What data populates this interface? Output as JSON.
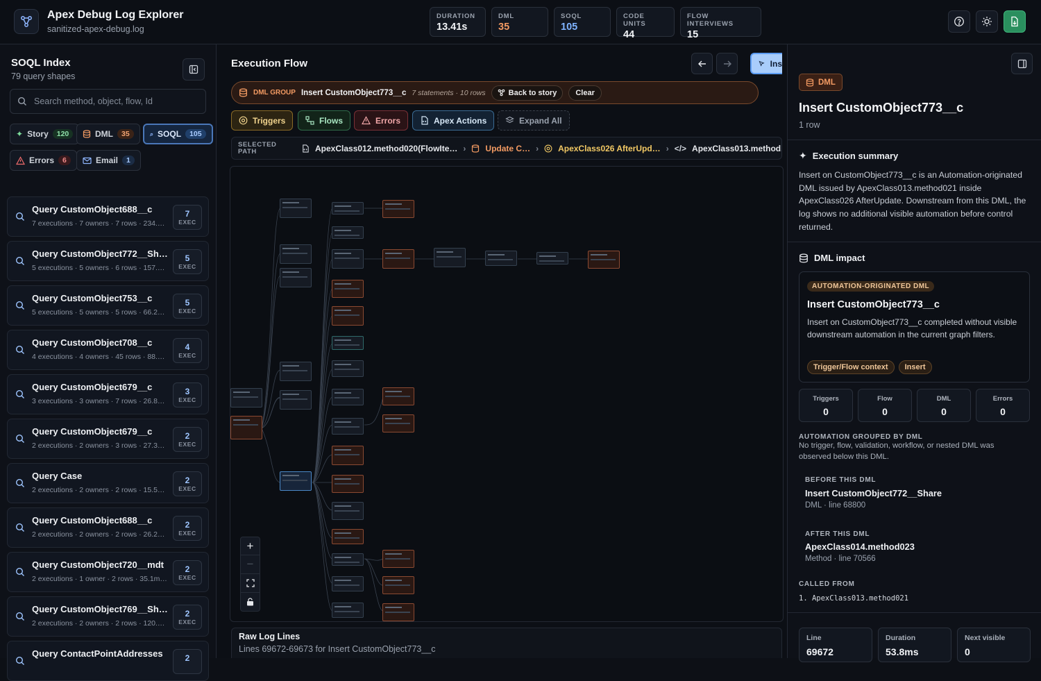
{
  "header": {
    "title": "Apex Debug Log Explorer",
    "file": "sanitized-apex-debug.log",
    "stats": [
      {
        "label": "DURATION",
        "value": "13.41s"
      },
      {
        "label": "DML",
        "value": "35"
      },
      {
        "label": "SOQL",
        "value": "105"
      },
      {
        "label": "CODE UNITS",
        "value": "44"
      },
      {
        "label": "FLOW INTERVIEWS",
        "value": "15"
      }
    ]
  },
  "sidebar": {
    "title": "SOQL Index",
    "subtitle": "79 query shapes",
    "search_placeholder": "Search method, object, flow, Id",
    "filters": [
      {
        "label": "Story",
        "count": "120"
      },
      {
        "label": "DML",
        "count": "35"
      },
      {
        "label": "SOQL",
        "count": "105"
      },
      {
        "label": "Errors",
        "count": "6"
      },
      {
        "label": "Email",
        "count": "1"
      }
    ],
    "exec_label": "EXEC",
    "queries": [
      {
        "name": "Query CustomObject688__c",
        "meta": "7 executions · 7 owners · 7 rows · 234.…",
        "count": "7"
      },
      {
        "name": "Query CustomObject772__Sh…",
        "meta": "5 executions · 5 owners · 6 rows · 157.…",
        "count": "5"
      },
      {
        "name": "Query CustomObject753__c",
        "meta": "5 executions · 5 owners · 5 rows · 66.2…",
        "count": "5"
      },
      {
        "name": "Query CustomObject708__c",
        "meta": "4 executions · 4 owners · 45 rows · 88.…",
        "count": "4"
      },
      {
        "name": "Query CustomObject679__c",
        "meta": "3 executions · 3 owners · 7 rows · 26.8…",
        "count": "3"
      },
      {
        "name": "Query CustomObject679__c",
        "meta": "2 executions · 2 owners · 3 rows · 27.3…",
        "count": "2"
      },
      {
        "name": "Query Case",
        "meta": "2 executions · 2 owners · 2 rows · 15.5…",
        "count": "2"
      },
      {
        "name": "Query CustomObject688__c",
        "meta": "2 executions · 2 owners · 2 rows · 26.2…",
        "count": "2"
      },
      {
        "name": "Query CustomObject720__mdt",
        "meta": "2 executions · 1 owner · 2 rows · 35.1m…",
        "count": "2"
      },
      {
        "name": "Query CustomObject769__Sh…",
        "meta": "2 executions · 2 owners · 2 rows · 120.…",
        "count": "2"
      },
      {
        "name": "Query ContactPointAddresses",
        "meta": "",
        "count": "2"
      }
    ]
  },
  "main": {
    "title": "Execution Flow",
    "inspect_label": "Ins",
    "group": {
      "tag": "DML GROUP",
      "name": "Insert CustomObject773__c",
      "meta": "7 statements · 10 rows",
      "back": "Back to story",
      "clear": "Clear"
    },
    "filters": [
      "Triggers",
      "Flows",
      "Errors",
      "Apex Actions",
      "Expand All"
    ],
    "path_label_1": "SELECTED",
    "path_label_2": "PATH",
    "path": [
      "ApexClass012.method020(FlowIte…",
      "Update C…",
      "ApexClass026 AfterUpd…",
      "ApexClass013.method."
    ],
    "raw_title": "Raw Log Lines",
    "raw_sub": "Lines 69672-69673 for Insert CustomObject773__c"
  },
  "detail": {
    "badge": "DML",
    "title": "Insert CustomObject773__c",
    "rows": "1 row",
    "summary_title": "Execution summary",
    "summary": "Insert on CustomObject773__c is an Automation-originated DML issued by ApexClass013.method021 inside ApexClass026 AfterUpdate. Downstream from this DML, the log shows no additional visible automation before control returned.",
    "impact_title": "DML impact",
    "impact_tag": "AUTOMATION-ORIGINATED DML",
    "impact_name": "Insert CustomObject773__c",
    "impact_text": "Insert on CustomObject773__c completed without visible downstream automation in the current graph filters.",
    "chips": [
      "Trigger/Flow context",
      "Insert"
    ],
    "counts": [
      {
        "label": "Triggers",
        "value": "0"
      },
      {
        "label": "Flow",
        "value": "0"
      },
      {
        "label": "DML",
        "value": "0"
      },
      {
        "label": "Errors",
        "value": "0"
      }
    ],
    "grouped_title": "AUTOMATION GROUPED BY DML",
    "grouped_text": "No trigger, flow, validation, workflow, or nested DML was observed below this DML.",
    "before_title": "BEFORE THIS DML",
    "before_name": "Insert CustomObject772__Share",
    "before_meta": "DML · line 68800",
    "after_title": "AFTER THIS DML",
    "after_name": "ApexClass014.method023",
    "after_meta": "Method · line 70566",
    "called_title": "CALLED FROM",
    "called_item": "1. ApexClass013.method021",
    "bottom": [
      {
        "label": "Line",
        "value": "69672"
      },
      {
        "label": "Duration",
        "value": "53.8ms"
      },
      {
        "label": "Next visible",
        "value": "0"
      }
    ]
  }
}
